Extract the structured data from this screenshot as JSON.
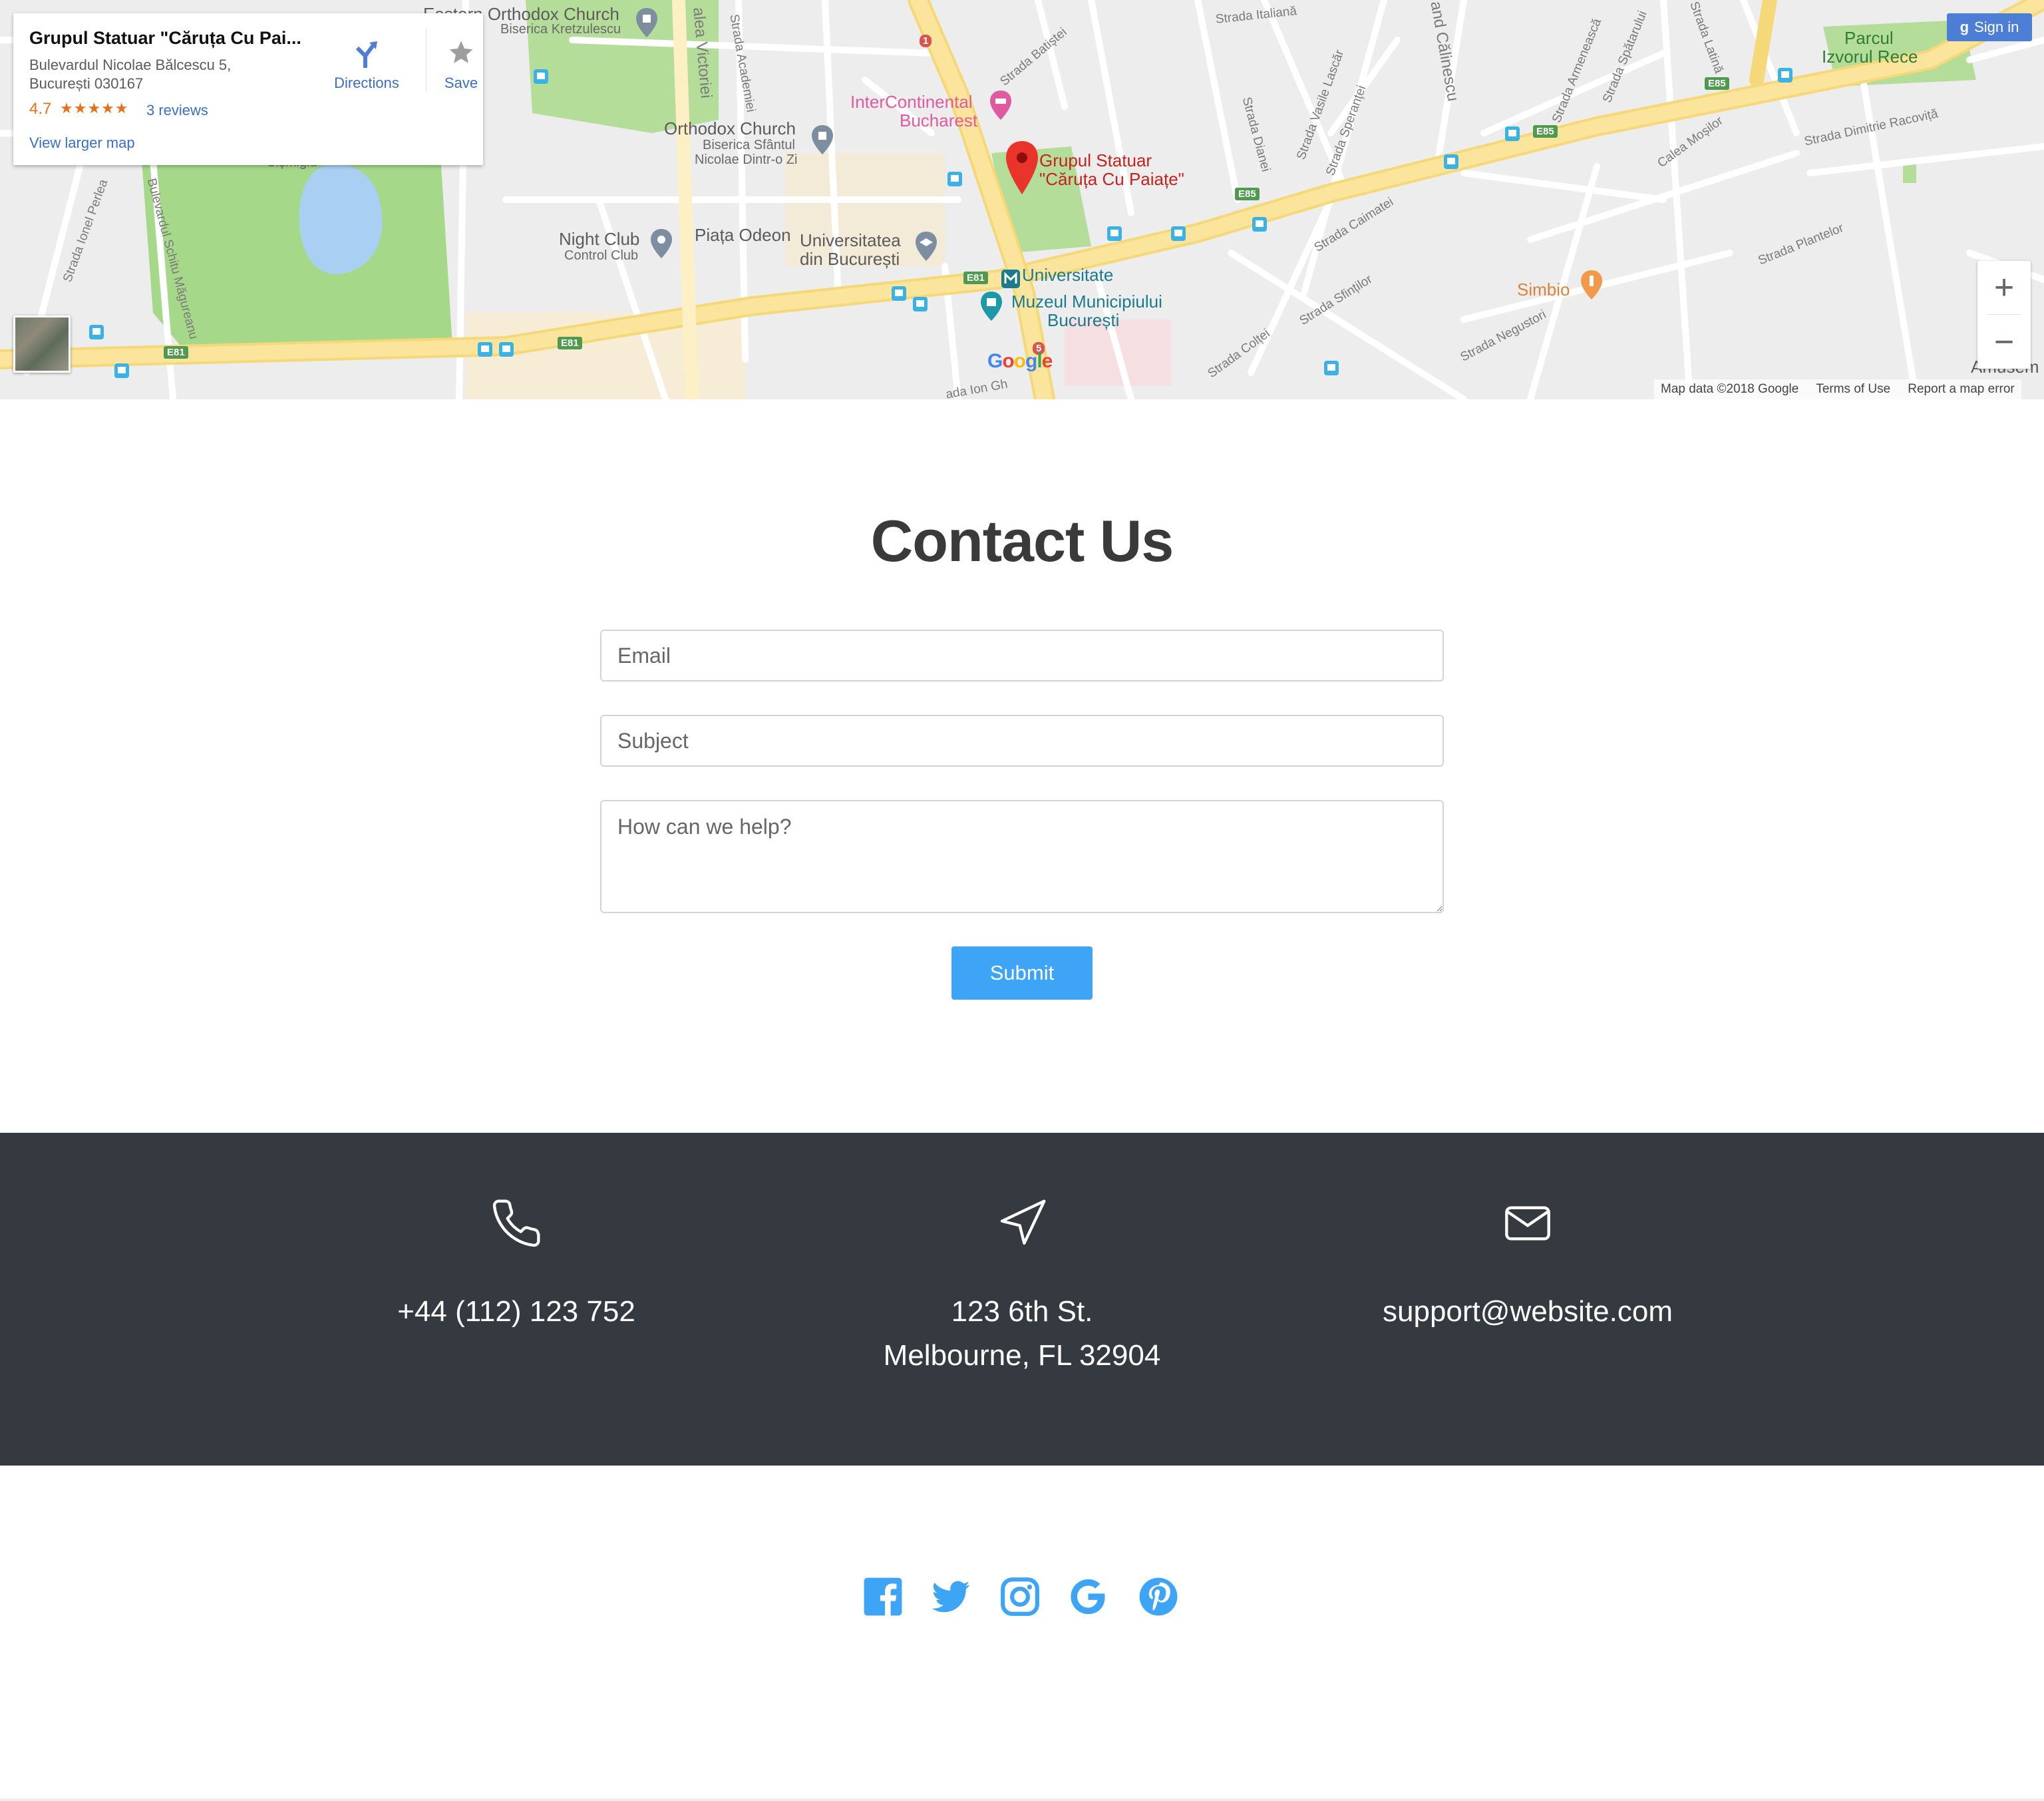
{
  "map": {
    "info_card": {
      "title": "Grupul Statuar \"Căruța Cu Pai...",
      "address_line1": "Bulevardul Nicolae Bălcescu 5,",
      "address_line2": "București 030167",
      "rating": "4.7",
      "stars": "★★★★★",
      "reviews": "3 reviews",
      "view_larger": "View larger map",
      "directions": "Directions",
      "save": "Save"
    },
    "sign_in": "Sign in",
    "zoom_in": "+",
    "zoom_out": "−",
    "footer": {
      "map_data": "Map data ©2018 Google",
      "terms": "Terms of Use",
      "report": "Report a map error"
    },
    "labels": {
      "eastern_church": "Eastern Orthodox Church",
      "kretzulescu": "Biserica Kretzulescu",
      "orthodox_church": "Orthodox Church",
      "biserica_sfantul": "Biserica Sfântul",
      "nicolae": "Nicolae Dintr-o Zi",
      "intercontinental": "InterContinental",
      "bucharest": "Bucharest",
      "grupul_1": "Grupul Statuar",
      "grupul_2": "\"Căruța Cu Paiațe\"",
      "night_club": "Night Club",
      "control_club": "Control Club",
      "piata_odeon": "Piața Odeon",
      "universitatea": "Universitatea",
      "din_bucuresti": "din București",
      "universitate": "Universitate",
      "muzeul": "Muzeul Municipiului",
      "muzeul_2": "București",
      "simbio": "Simbio",
      "parcul": "Parcul",
      "izvorul": "Izvorul Rece",
      "cismigiu": "Cișmigiu",
      "amusem": "Amusem",
      "strada_italiana": "Strada Italiană",
      "strada_batistei": "Strada Batiștei",
      "strada_academiei": "Strada Academiei",
      "calea_victoriei": "alea Victoriei",
      "strada_ionel": "Strada Ionel Perlea",
      "bulevardul_schitu": "Bulevardul Schitu Măgureanu",
      "strada_dianei": "Strada Dianei",
      "strada_vasile": "Strada Vasile Lascăr",
      "strada_sperantei": "Strada Speranței",
      "strada_armeneasca": "Strada Armenească",
      "strada_spatarului": "Strada Spătarului",
      "strada_latina": "Strada Latină",
      "calea_mosilor": "Calea Moșilor",
      "strada_dimitrie": "Strada Dimitrie Racoviță",
      "strada_plantelor": "Strada Plantelor",
      "strada_caimatei": "Strada Caimatei",
      "strada_sfintilor": "Strada Sfinților",
      "strada_coltei": "Strada Colței",
      "strada_negustori": "Strada Negustori",
      "calinescu": "and Călinescu",
      "strada_ion": "ada Ion Gh",
      "google": "Google"
    },
    "badges": [
      "E81",
      "E81",
      "E81",
      "E85",
      "E85",
      "E85",
      "1",
      "5"
    ]
  },
  "contact": {
    "title": "Contact Us",
    "email_placeholder": "Email",
    "subject_placeholder": "Subject",
    "help_placeholder": "How can we help?",
    "submit": "Submit"
  },
  "info": {
    "phone": "+44 (112) 123 752",
    "address_line1": "123 6th St.",
    "address_line2": "Melbourne, FL 32904",
    "email": "support@website.com"
  },
  "social": {
    "icons": [
      "facebook-icon",
      "twitter-icon",
      "instagram-icon",
      "google-icon",
      "pinterest-icon"
    ],
    "color": "#3ea4f6"
  },
  "colors": {
    "accent": "#3ea4f6",
    "band": "#353940",
    "title": "#3a3a3a"
  }
}
